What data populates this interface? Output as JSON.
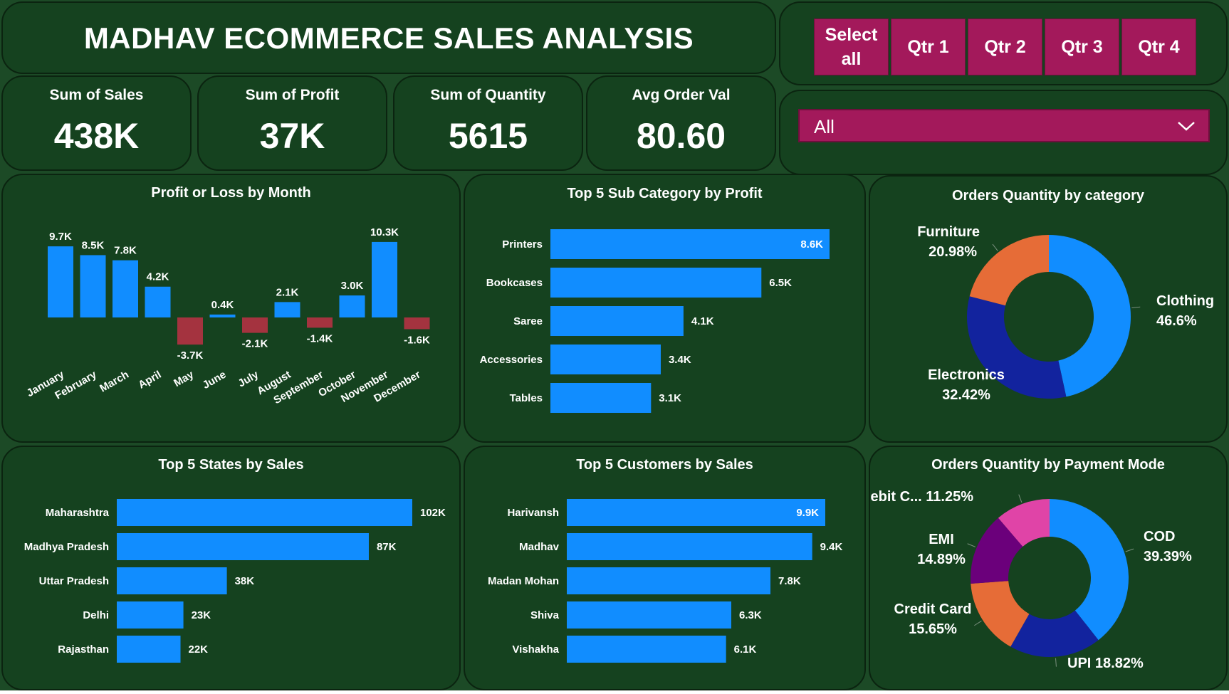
{
  "header": {
    "title": "MADHAV ECOMMERCE SALES ANALYSIS"
  },
  "kpis": [
    {
      "label": "Sum of Sales",
      "value": "438K"
    },
    {
      "label": "Sum of Profit",
      "value": "37K"
    },
    {
      "label": "Sum of Quantity",
      "value": "5615"
    },
    {
      "label": "Avg Order Val",
      "value": "80.60"
    }
  ],
  "quarter_slicer": {
    "buttons": [
      "Select all",
      "Qtr 1",
      "Qtr 2",
      "Qtr 3",
      "Qtr 4"
    ]
  },
  "state_filter": {
    "selected": "All"
  },
  "colors": {
    "bar": "#118dff",
    "negative": "#a4333f",
    "panel": "#15421f",
    "slicer": "#a3195b"
  },
  "chart_data": [
    {
      "type": "bar",
      "title": "Profit or Loss by Month",
      "categories": [
        "January",
        "February",
        "March",
        "April",
        "May",
        "June",
        "July",
        "August",
        "September",
        "October",
        "November",
        "December"
      ],
      "values": [
        9.7,
        8.5,
        7.8,
        4.2,
        -3.7,
        0.4,
        -2.1,
        2.1,
        -1.4,
        3.0,
        10.3,
        -1.6
      ],
      "labels": [
        "9.7K",
        "8.5K",
        "7.8K",
        "4.2K",
        "-3.7K",
        "0.4K",
        "-2.1K",
        "2.1K",
        "-1.4K",
        "3.0K",
        "10.3K",
        "-1.6K"
      ]
    },
    {
      "type": "bar",
      "title": "Top 5 Sub Category by Profit",
      "categories": [
        "Printers",
        "Bookcases",
        "Saree",
        "Accessories",
        "Tables"
      ],
      "values": [
        8.6,
        6.5,
        4.1,
        3.4,
        3.1
      ],
      "labels": [
        "8.6K",
        "6.5K",
        "4.1K",
        "3.4K",
        "3.1K"
      ]
    },
    {
      "type": "pie",
      "title": "Orders Quantity by category",
      "slices": [
        {
          "name": "Clothing",
          "pct": 46.6,
          "label": "46.6%",
          "color": "#118dff"
        },
        {
          "name": "Electronics",
          "pct": 32.42,
          "label": "32.42%",
          "color": "#12239e"
        },
        {
          "name": "Furniture",
          "pct": 20.98,
          "label": "20.98%",
          "color": "#e66c37"
        }
      ]
    },
    {
      "type": "bar",
      "title": "Top 5 States by Sales",
      "categories": [
        "Maharashtra",
        "Madhya Pradesh",
        "Uttar Pradesh",
        "Delhi",
        "Rajasthan"
      ],
      "values": [
        102,
        87,
        38,
        23,
        22
      ],
      "labels": [
        "102K",
        "87K",
        "38K",
        "23K",
        "22K"
      ]
    },
    {
      "type": "bar",
      "title": "Top 5 Customers by Sales",
      "categories": [
        "Harivansh",
        "Madhav",
        "Madan Mohan",
        "Shiva",
        "Vishakha"
      ],
      "values": [
        9.9,
        9.4,
        7.8,
        6.3,
        6.1
      ],
      "labels": [
        "9.9K",
        "9.4K",
        "7.8K",
        "6.3K",
        "6.1K"
      ]
    },
    {
      "type": "pie",
      "title": "Orders Quantity by Payment Mode",
      "slices": [
        {
          "name": "COD",
          "pct": 39.39,
          "label": "39.39%",
          "color": "#118dff"
        },
        {
          "name": "UPI",
          "pct": 18.82,
          "label": "18.82%",
          "color": "#12239e"
        },
        {
          "name": "Credit Card",
          "pct": 15.65,
          "label": "15.65%",
          "color": "#e66c37"
        },
        {
          "name": "EMI",
          "pct": 14.89,
          "label": "14.89%",
          "color": "#6b007b"
        },
        {
          "name": "Debit C...",
          "pct": 11.25,
          "label": "11.25%",
          "color": "#e044a7"
        }
      ]
    }
  ]
}
